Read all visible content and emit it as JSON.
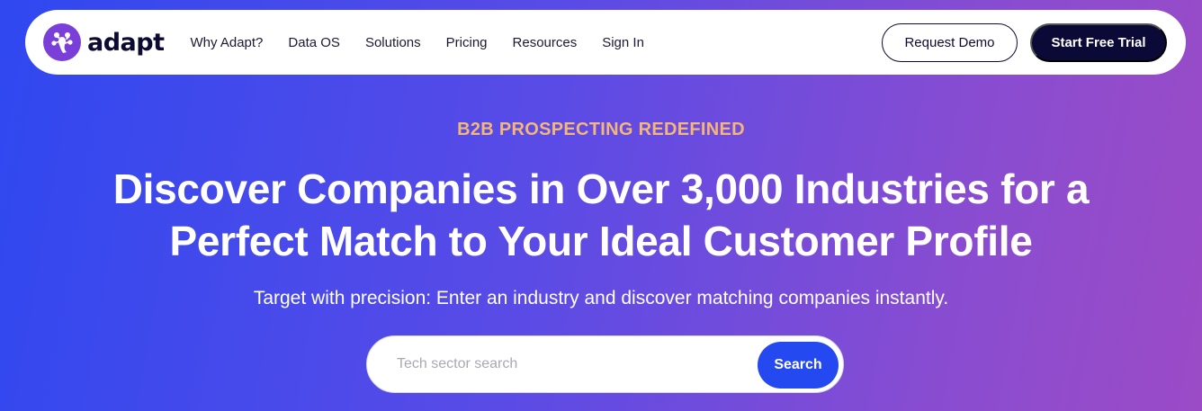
{
  "brand": {
    "name": "adapt",
    "logo_icon": "adapt-logo-icon",
    "logo_color": "#7a3fd8"
  },
  "nav": {
    "links": [
      "Why Adapt?",
      "Data OS",
      "Solutions",
      "Pricing",
      "Resources",
      "Sign In"
    ],
    "request_demo_label": "Request Demo",
    "start_trial_label": "Start Free Trial"
  },
  "hero": {
    "eyebrow": "B2B PROSPECTING REDEFINED",
    "headline_line1": "Discover Companies in Over 3,000 Industries for a",
    "headline_line2": "Perfect Match to Your Ideal Customer Profile",
    "subhead": "Target with precision: Enter an industry and discover matching companies instantly."
  },
  "search": {
    "placeholder": "Tech sector search",
    "button_label": "Search"
  },
  "colors": {
    "accent": "#2449f0",
    "eyebrow": "#f4b679",
    "dark_button": "#0b0a36"
  }
}
